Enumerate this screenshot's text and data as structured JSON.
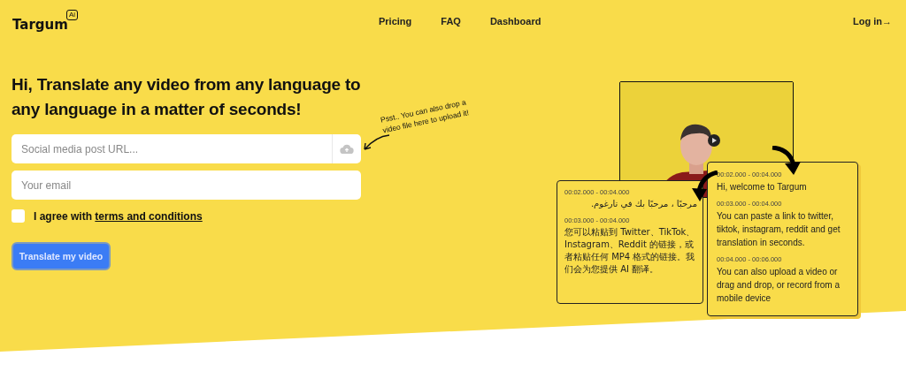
{
  "logo": {
    "name": "Targum",
    "badge": "Ai"
  },
  "nav": [
    {
      "label": "Pricing"
    },
    {
      "label": "FAQ"
    },
    {
      "label": "Dashboard"
    }
  ],
  "login": {
    "label": "Log in",
    "arrow": "→"
  },
  "headline": "Hi, Translate any video from any language to any language in a matter of seconds!",
  "url_field": {
    "placeholder": "Social media post URL..."
  },
  "hint": "Psst.. You can also drop a video file here to upload it!",
  "email_field": {
    "placeholder": "Your email"
  },
  "agree": {
    "checked": false,
    "text": "I agree with ",
    "link": "terms and conditions"
  },
  "submit": {
    "label": "Translate my video"
  },
  "cards": [
    {
      "kind": "back",
      "segments": [
        {
          "time": "00:02.000 - 00:04.000",
          "text": "مرحبًا ، مرحبًا بك في تارغوم.",
          "kind": "rtl"
        },
        {
          "time": "00:03.000 - 00:04.000",
          "text": "您可以粘贴到 Twitter、TikTok、Instagram、Reddit 的链接，或者粘贴任何 MP4 格式的链接。我们会为您提供 AI 翻译。",
          "kind": "ltr"
        }
      ]
    },
    {
      "kind": "front",
      "segments": [
        {
          "time": "00:02.000 - 00:04.000",
          "text": "Hi, welcome to Targum",
          "kind": "ltr"
        },
        {
          "time": "00:03.000 - 00:04.000",
          "text": "You can paste a link to twitter, tiktok, instagram, reddit and get translation in seconds.",
          "kind": "ltr"
        },
        {
          "time": "00:04.000 - 00:06.000",
          "text": "You can also upload a video or drag and drop, or record from a mobile device",
          "kind": "ltr"
        }
      ]
    }
  ]
}
